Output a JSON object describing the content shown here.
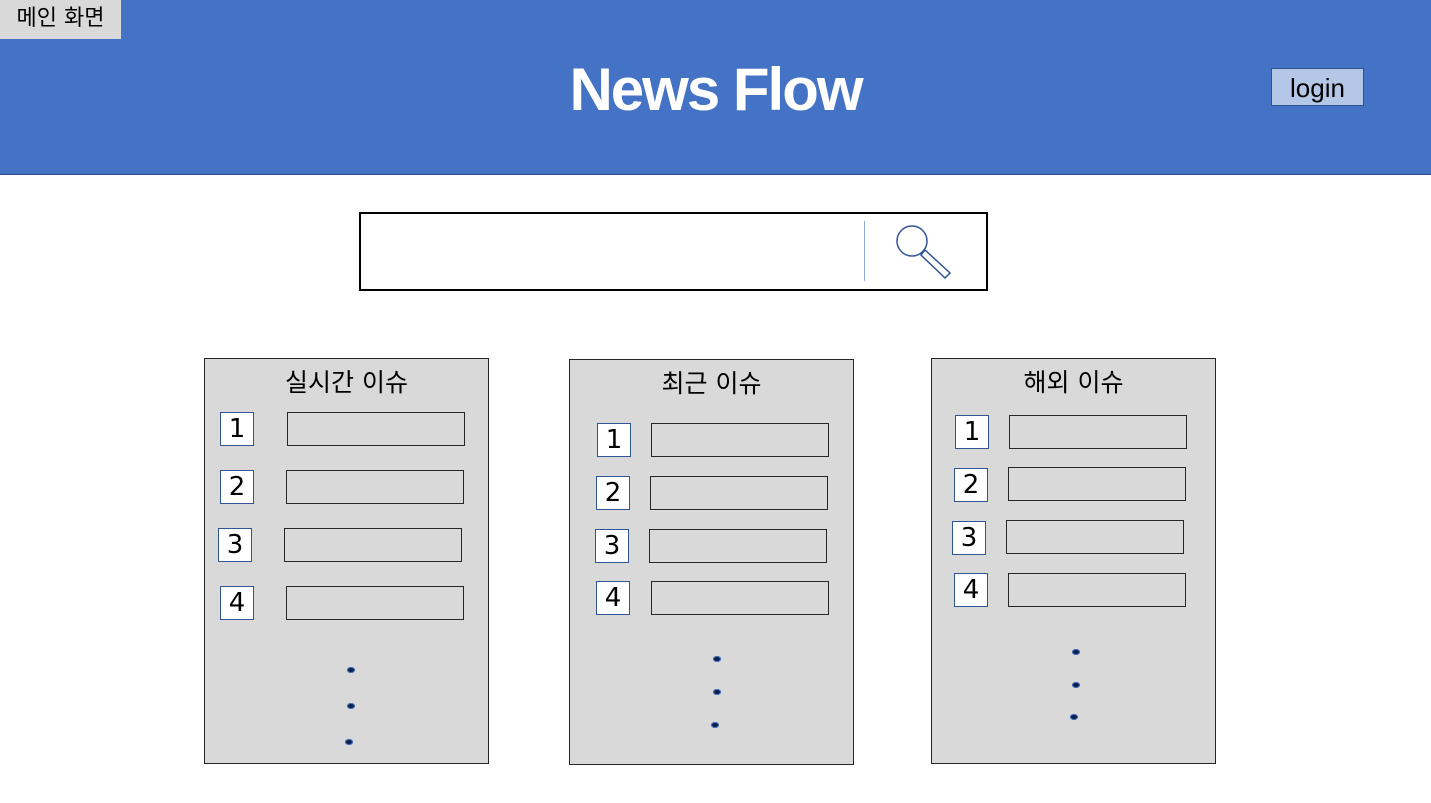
{
  "page_label": "메인 화면",
  "header": {
    "title": "News Flow",
    "login_label": "login",
    "background_color": "#4472c4"
  },
  "search": {
    "value": "",
    "placeholder": "",
    "icon": "search-icon"
  },
  "panels": [
    {
      "title": "실시간 이슈",
      "ranks": [
        "1",
        "2",
        "3",
        "4"
      ]
    },
    {
      "title": "최근 이슈",
      "ranks": [
        "1",
        "2",
        "3",
        "4"
      ]
    },
    {
      "title": "해외 이슈",
      "ranks": [
        "1",
        "2",
        "3",
        "4"
      ]
    }
  ]
}
